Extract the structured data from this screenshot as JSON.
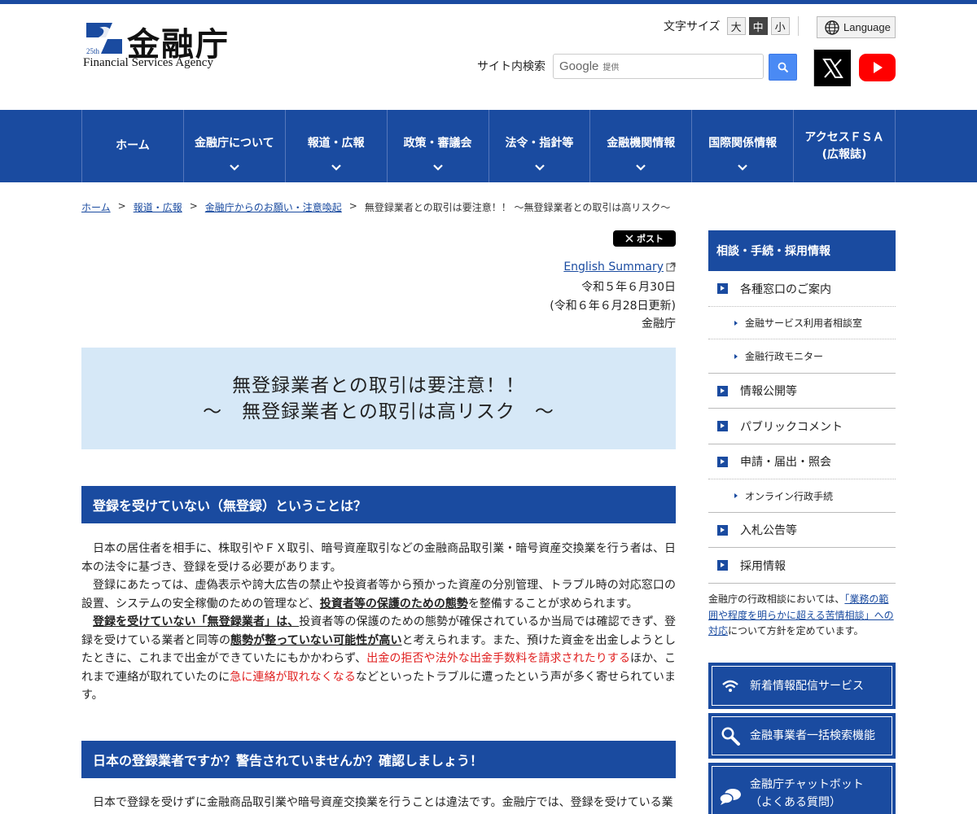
{
  "colors": {
    "brand": "#1a4ba0",
    "title_bg": "#d6e8f7",
    "warn": "#e02020",
    "youtube": "#ff0000"
  },
  "header": {
    "logo_title": "金融庁",
    "logo_sub": "Financial Services Agency",
    "logo_badge": "25th",
    "font_size_label": "文字サイズ",
    "font_sizes": [
      "大",
      "中",
      "小"
    ],
    "font_size_selected": "中",
    "language_label": "Language",
    "search_label": "サイト内検索",
    "search_brand": "Google",
    "search_provided": "提供",
    "search_icon": "search-icon",
    "social": [
      "x-icon",
      "youtube-icon"
    ]
  },
  "nav": {
    "items": [
      "ホーム",
      "金融庁について",
      "報道・広報",
      "政策・審議会",
      "法令・指針等",
      "金融機関情報",
      "国際関係情報",
      "アクセスＦＳＡ",
      "(広報誌)"
    ]
  },
  "breadcrumb": {
    "items": [
      "ホーム",
      "報道・広報",
      "金融庁からのお願い・注意喚起"
    ],
    "current": "無登録業者との取引は要注意！！ ～無登録業者との取引は高リスク～",
    "separator": ">"
  },
  "main": {
    "post_label": "ポスト",
    "english_summary": "English Summary",
    "date": "令和５年６月30日",
    "updated": "(令和６年６月28日更新)",
    "author": "金融庁",
    "title_line1": "無登録業者との取引は要注意！！",
    "title_line2": "～　無登録業者との取引は高リスク　～",
    "section1_heading": "登録を受けていない（無登録）ということは？",
    "p1": "日本の居住者を相手に、株取引やＦＸ取引、暗号資産取引などの金融商品取引業・暗号資産交換業を行う者は、日本の法令に基づき、登録を受ける必要があります。",
    "p2_a": "登録にあたっては、虚偽表示や誇大広告の禁止や投資者等から預かった資産の分別管理、トラブル時の対応窓口の設置、システムの安全稼働のための管理など、",
    "p2_b": "投資者等の保護のための態勢",
    "p2_c": "を整備することが求められます。",
    "p3_a": "登録を受けていない「無登録業者」は、",
    "p3_b": "投資者等の保護のための態勢が確保されているか当局では確認できず、登録を受けている業者と同等の",
    "p3_c": "態勢が整っていない可能性が高い",
    "p3_d": "と考えられます。また、預けた資金を出金しようとしたときに、これまで出金ができていたにもかかわらず、",
    "p3_e": "出金の拒否や法外な出金手数料を請求されたりする",
    "p3_f": "ほか、これまで連絡が取れていたのに",
    "p3_g": "急に連絡が取れなくなる",
    "p3_h": "などといったトラブルに遭ったという声が多く寄せられています。",
    "section2_heading": "日本の登録業者ですか？警告されていませんか？確認しましょう！",
    "p4": "日本で登録を受けずに金融商品取引業や暗号資産交換業を行うことは違法です。金融庁では、登録を受けている業"
  },
  "sidebar": {
    "heading": "相談・手続・採用情報",
    "item1": "各種窓口のご案内",
    "sub1": "金融サービス利用者相談室",
    "sub2": "金融行政モニター",
    "item2": "情報公開等",
    "item3": "パブリックコメント",
    "item4": "申請・届出・照会",
    "sub3": "オンライン行政手続",
    "item5": "入札公告等",
    "item6": "採用情報",
    "note_a": "金融庁の行政相談においては、",
    "note_link": "「業務の範囲や程度を明らかに超える苦情相談」への対応",
    "note_b": "について方針を定めています。",
    "btn1": "新着情報配信サービス",
    "btn2": "金融事業者一括検索機能",
    "btn3_line1": "金融庁チャットボット",
    "btn3_line2": "（よくある質問）"
  }
}
